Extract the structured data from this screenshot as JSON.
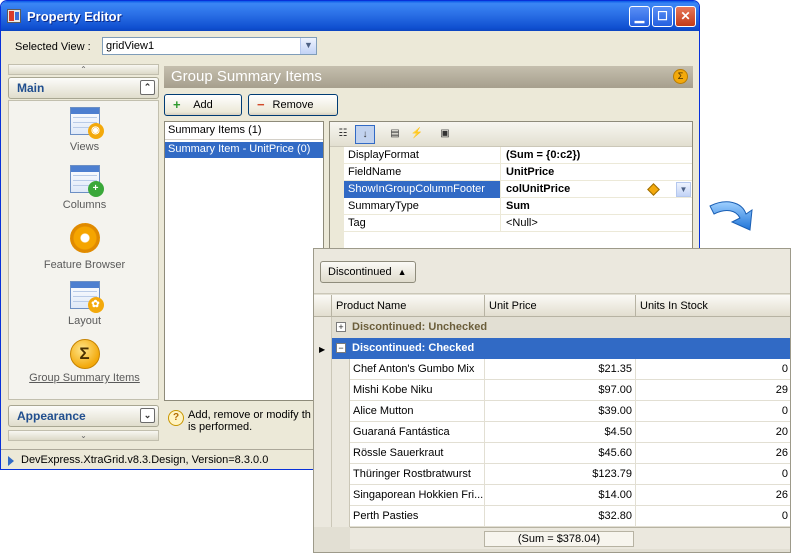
{
  "window": {
    "title": "Property Editor"
  },
  "selected_view": {
    "label": "Selected View :",
    "value": "gridView1"
  },
  "nav": {
    "main_group": "Main",
    "items": [
      {
        "id": "views",
        "label": "Views",
        "icon": "views-icon"
      },
      {
        "id": "columns",
        "label": "Columns",
        "icon": "columns-icon"
      },
      {
        "id": "feature-browser",
        "label": "Feature Browser",
        "icon": "gear-icon"
      },
      {
        "id": "layout",
        "label": "Layout",
        "icon": "layout-icon"
      },
      {
        "id": "group-summary-items",
        "label": "Group Summary Items",
        "icon": "sigma-icon",
        "selected": true
      }
    ],
    "appearance_group": "Appearance"
  },
  "panel": {
    "title": "Group Summary Items",
    "add_label": "Add",
    "remove_label": "Remove",
    "list_header": "Summary Items (1)",
    "list_items": [
      "Summary Item - UnitPrice (0)"
    ],
    "description": "Add, remove or modify th grouping is performed."
  },
  "property_grid": {
    "rows": [
      {
        "name": "DisplayFormat",
        "value": "(Sum = {0:c2})"
      },
      {
        "name": "FieldName",
        "value": "UnitPrice"
      },
      {
        "name": "ShowInGroupColumnFooter",
        "value": "colUnitPrice",
        "selected": true
      },
      {
        "name": "SummaryType",
        "value": "Sum"
      },
      {
        "name": "Tag",
        "value": "<Null>"
      }
    ]
  },
  "status": {
    "text": "DevExpress.XtraGrid.v8.3.Design, Version=8.3.0.0"
  },
  "grid": {
    "group_chip": "Discontinued",
    "columns": [
      "Product Name",
      "Unit Price",
      "Units In Stock"
    ],
    "groups": [
      {
        "label": "Discontinued: Unchecked",
        "expanded": false
      },
      {
        "label": "Discontinued: Checked",
        "expanded": true,
        "selected": true
      }
    ],
    "rows": [
      {
        "product": "Chef Anton's Gumbo Mix",
        "price": "$21.35",
        "stock": "0"
      },
      {
        "product": "Mishi Kobe Niku",
        "price": "$97.00",
        "stock": "29"
      },
      {
        "product": "Alice Mutton",
        "price": "$39.00",
        "stock": "0"
      },
      {
        "product": "Guaraná Fantástica",
        "price": "$4.50",
        "stock": "20"
      },
      {
        "product": "Rössle Sauerkraut",
        "price": "$45.60",
        "stock": "26"
      },
      {
        "product": "Thüringer Rostbratwurst",
        "price": "$123.79",
        "stock": "0"
      },
      {
        "product": "Singaporean Hokkien Fri...",
        "price": "$14.00",
        "stock": "26"
      },
      {
        "product": "Perth Pasties",
        "price": "$32.80",
        "stock": "0"
      }
    ],
    "footer_summary": "(Sum = $378.04)"
  }
}
